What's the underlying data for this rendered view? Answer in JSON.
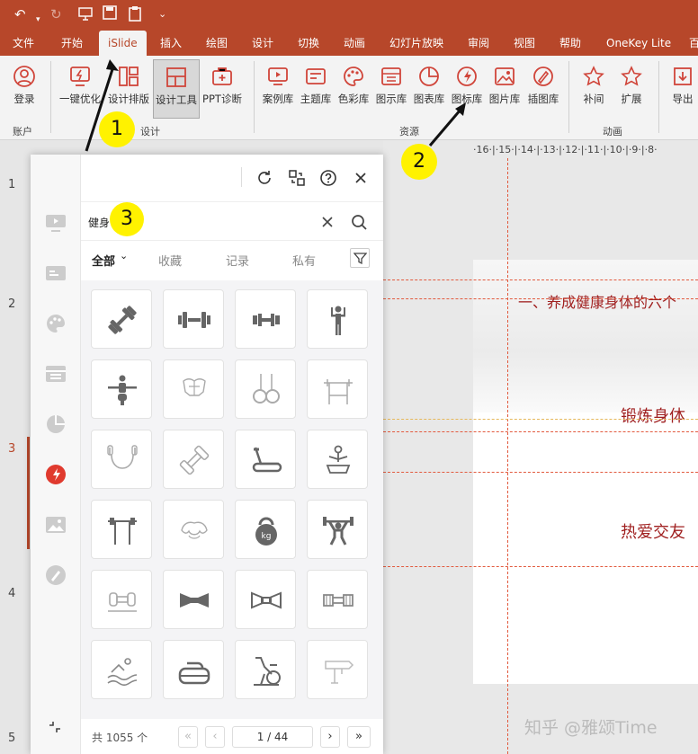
{
  "colors": {
    "accent": "#b7472a",
    "icon_active": "#e03a2e",
    "callout": "#fff200",
    "slide_text": "#a02020"
  },
  "quick_access": {
    "undo_icon": "undo-icon",
    "redo_icon": "redo-icon",
    "present_icon": "present-icon",
    "save_icon": "save-icon",
    "paste_icon": "paste-icon",
    "more_icon": "more-icon"
  },
  "tabs": [
    "文件",
    "开始",
    "iSlide",
    "插入",
    "绘图",
    "设计",
    "切换",
    "动画",
    "幻灯片放映",
    "审阅",
    "视图",
    "帮助",
    "OneKey Lite",
    "百"
  ],
  "ribbon": {
    "buttons": [
      {
        "label": "登录",
        "icon": "user-icon"
      },
      {
        "label": "一键优化",
        "icon": "optimize-icon"
      },
      {
        "label": "设计排版",
        "icon": "layout-icon"
      },
      {
        "label": "设计工具",
        "icon": "design-tools-icon"
      },
      {
        "label": "PPT诊断",
        "icon": "diagnose-icon"
      },
      {
        "label": "案例库",
        "icon": "case-icon"
      },
      {
        "label": "主题库",
        "icon": "theme-icon"
      },
      {
        "label": "色彩库",
        "icon": "palette-icon"
      },
      {
        "label": "图示库",
        "icon": "diagram-icon"
      },
      {
        "label": "图表库",
        "icon": "chart-icon"
      },
      {
        "label": "图标库",
        "icon": "icon-lib-icon"
      },
      {
        "label": "图片库",
        "icon": "image-icon"
      },
      {
        "label": "插图库",
        "icon": "illustration-icon"
      },
      {
        "label": "补间",
        "icon": "star-icon"
      },
      {
        "label": "扩展",
        "icon": "star-plus-icon"
      },
      {
        "label": "导出",
        "icon": "export-icon"
      }
    ],
    "groups": [
      "账户",
      "设计",
      "资源",
      "动画"
    ]
  },
  "ruler_text": "·16·|·15·|·14·|·13·|·12·|·11·|·10·|·9·|·8·",
  "slide_numbers": [
    "1",
    "2",
    "3",
    "4",
    "5"
  ],
  "slide": {
    "line1": "一、养成健康身体的六个",
    "line2": "锻炼身体",
    "line3": "热爱交友"
  },
  "panel": {
    "search": {
      "value": "健身"
    },
    "filters": [
      "全部",
      "收藏",
      "记录",
      "私有"
    ],
    "filter_arrow": "⌄",
    "total": "共 1055 个",
    "page": "1 / 44",
    "icons": [
      "dumbbell-diagonal-icon",
      "dumbbell-icon",
      "barbell-small-icon",
      "person-lifting-icon",
      "rowing-machine-person-icon",
      "muscle-torso-icon",
      "gymnastic-rings-icon",
      "bench-press-rack-icon",
      "jump-rope-icon",
      "dumbbell-diagonal-outline-icon",
      "treadmill-icon",
      "massage-chair-icon",
      "barbell-stand-icon",
      "muscle-arms-icon",
      "kettlebell-icon",
      "weightlifter-icon",
      "dumbbell-rack-icon",
      "bowtie-dumbbell-icon",
      "bowtie-dumbbell-outline-icon",
      "hex-dumbbell-icon",
      "swimming-icon",
      "curling-stone-icon",
      "exercise-bike-icon",
      "drill-icon"
    ],
    "kettlebell_label": "kg"
  },
  "callouts": [
    "1",
    "2",
    "3"
  ],
  "watermark": "知乎 @雅颂Time"
}
